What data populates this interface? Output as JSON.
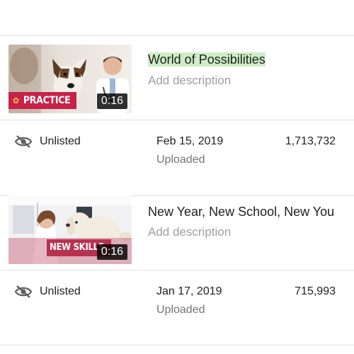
{
  "videos": [
    {
      "title": "World of Possibilities",
      "description_placeholder": "Add description",
      "thumbnail_badge": "PRACTICE",
      "duration": "0:16",
      "visibility": "Unlisted",
      "date": "Feb 15, 2019",
      "status": "Uploaded",
      "views": "1,713,732"
    },
    {
      "title": "New Year, New School, New You",
      "description_placeholder": "Add description",
      "thumbnail_badge": "NEW SKILLS.",
      "duration": "0:16",
      "visibility": "Unlisted",
      "date": "Jan 17, 2019",
      "status": "Uploaded",
      "views": "715,993"
    }
  ],
  "colors": {
    "badge": "#c8214a",
    "title_highlight": "#cdeec4",
    "divider": "#e0e0e0",
    "muted_text": "#9e9e9e"
  },
  "icons": {
    "visibility": "eye-off-icon",
    "badge": "paw-icon"
  }
}
